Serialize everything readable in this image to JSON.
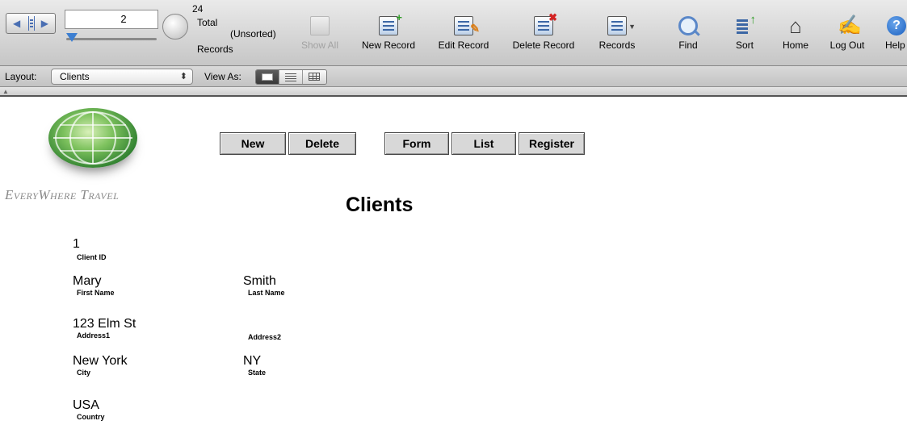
{
  "toolbar": {
    "current_record": "2",
    "found_total": "24",
    "total_label": "Total",
    "sort_state": "(Unsorted)",
    "records_label": "Records",
    "buttons": [
      {
        "label": "Show All",
        "icon": "show-all-icon",
        "enabled": false
      },
      {
        "label": "New Record",
        "icon": "new-record-icon",
        "enabled": true
      },
      {
        "label": "Edit Record",
        "icon": "edit-record-icon",
        "enabled": true
      },
      {
        "label": "Delete Record",
        "icon": "delete-record-icon",
        "enabled": true
      },
      {
        "label": "Records",
        "icon": "records-menu-icon",
        "enabled": true
      },
      {
        "label": "Find",
        "icon": "find-icon",
        "enabled": true
      },
      {
        "label": "Sort",
        "icon": "sort-icon",
        "enabled": true
      },
      {
        "label": "Home",
        "icon": "home-icon",
        "enabled": true
      },
      {
        "label": "Log Out",
        "icon": "log-out-icon",
        "enabled": true
      },
      {
        "label": "Help",
        "icon": "help-icon",
        "enabled": true
      }
    ]
  },
  "layoutbar": {
    "layout_label": "Layout:",
    "layout_value": "Clients",
    "view_as_label": "View As:",
    "view_modes": [
      "form",
      "list",
      "table"
    ],
    "active_view": "form"
  },
  "content": {
    "brand": "EveryWhere Travel",
    "buttons": {
      "new": "New",
      "delete": "Delete",
      "form": "Form",
      "list": "List",
      "register": "Register"
    },
    "title": "Clients",
    "fields": {
      "client_id": {
        "value": "1",
        "label": "Client ID"
      },
      "first_name": {
        "value": "Mary",
        "label": "First Name"
      },
      "last_name": {
        "value": "Smith",
        "label": "Last Name"
      },
      "address1": {
        "value": "123 Elm St",
        "label": "Address1"
      },
      "address2": {
        "value": "",
        "label": "Address2"
      },
      "city": {
        "value": "New York",
        "label": "City"
      },
      "state": {
        "value": "NY",
        "label": "State"
      },
      "country": {
        "value": "USA",
        "label": "Country"
      }
    }
  },
  "colors": {
    "accent_blue": "#3d7fd1",
    "badge_green": "#2d9c24",
    "badge_red": "#d42222"
  }
}
